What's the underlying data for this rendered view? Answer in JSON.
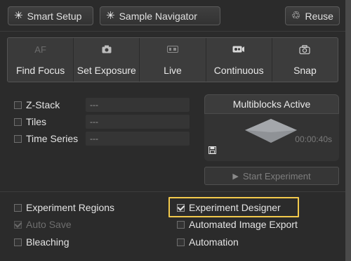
{
  "toolbar": {
    "smart_setup": "Smart Setup",
    "sample_navigator": "Sample Navigator",
    "reuse": "Reuse"
  },
  "tools": [
    {
      "label": "Find Focus",
      "icon_text": "AF",
      "icon": "autofocus-icon"
    },
    {
      "label": "Set Exposure",
      "icon": "camera-icon"
    },
    {
      "label": "Live",
      "icon": "live-icon"
    },
    {
      "label": "Continuous",
      "icon": "continuous-icon"
    },
    {
      "label": "Snap",
      "icon": "snap-camera-icon"
    }
  ],
  "dimensions": [
    {
      "label": "Z-Stack",
      "value": "---",
      "checked": false
    },
    {
      "label": "Tiles",
      "value": "---",
      "checked": false
    },
    {
      "label": "Time Series",
      "value": "---",
      "checked": false
    }
  ],
  "multiblocks": {
    "title": "Multiblocks Active",
    "time": "00:00:40s"
  },
  "start_experiment": "Start Experiment",
  "options_left": [
    {
      "label": "Experiment Regions",
      "checked": false,
      "disabled": false
    },
    {
      "label": "Auto Save",
      "checked": true,
      "disabled": true
    },
    {
      "label": "Bleaching",
      "checked": false,
      "disabled": false
    }
  ],
  "options_right": [
    {
      "label": "Experiment Designer",
      "checked": true,
      "disabled": false
    },
    {
      "label": "Automated Image Export",
      "checked": false,
      "disabled": false
    },
    {
      "label": "Automation",
      "checked": false,
      "disabled": false
    }
  ],
  "colors": {
    "highlight": "#f2c94c",
    "background": "#2b2b2b"
  }
}
